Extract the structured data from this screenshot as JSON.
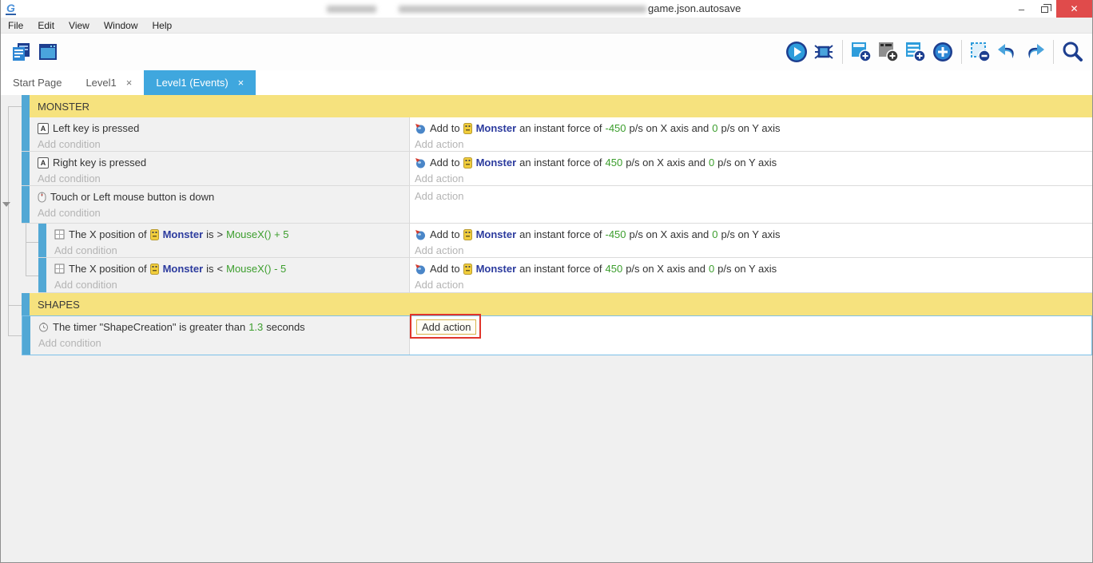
{
  "window": {
    "title_visible": "game.json.autosave",
    "minimize_glyph": "–",
    "close_glyph": "✕"
  },
  "icons": {
    "logo_letter": "G",
    "keyboard_letter": "A",
    "toolbar_left": [
      "project-manager",
      "start-scene"
    ],
    "toolbar_right": [
      "play",
      "debug",
      "add-event",
      "add-sub-event",
      "add-comment",
      "add-circle",
      "delete-selection",
      "undo",
      "redo",
      "search"
    ]
  },
  "menu": {
    "items": [
      "File",
      "Edit",
      "View",
      "Window",
      "Help"
    ]
  },
  "tabs": {
    "start_page": "Start Page",
    "level1": "Level1",
    "level1_events": "Level1 (Events)",
    "close_glyph": "×"
  },
  "groups": {
    "monster": "MONSTER",
    "shapes": "SHAPES"
  },
  "placeholders": {
    "condition": "Add condition",
    "action": "Add action"
  },
  "force_action": {
    "add_to": "Add to",
    "obj": "Monster",
    "mid": "an instant force of",
    "unit_x": "p/s on X axis and",
    "y": "0",
    "unit_y": "p/s on Y axis"
  },
  "events": {
    "left_key": {
      "condition": "Left key is pressed",
      "force_x": "-450"
    },
    "right_key": {
      "condition": "Right key is pressed",
      "force_x": "450"
    },
    "touch": {
      "condition": "Touch or Left mouse button is down"
    },
    "sub_gt": {
      "pre": "The X position of",
      "obj": "Monster",
      "is": "is",
      "op": ">",
      "expr": "MouseX() + 5",
      "force_x": "-450"
    },
    "sub_lt": {
      "pre": "The X position of",
      "obj": "Monster",
      "is": "is",
      "op": "<",
      "expr": "MouseX() - 5",
      "force_x": "450"
    },
    "timer": {
      "pre": "The timer \"ShapeCreation\" is greater than",
      "value": "1.3",
      "post": "seconds"
    }
  },
  "colors": {
    "accent": "#3fa7de",
    "bar": "#52a8d5",
    "yellow": "#f6e27e",
    "green": "#3c9e2d",
    "navy": "#2c3b9e",
    "ph": "#b4b4b4",
    "red": "#e0352b",
    "closered": "#e04b4b",
    "selborder": "#7cc0e8",
    "focusborder": "#d9b34b"
  }
}
